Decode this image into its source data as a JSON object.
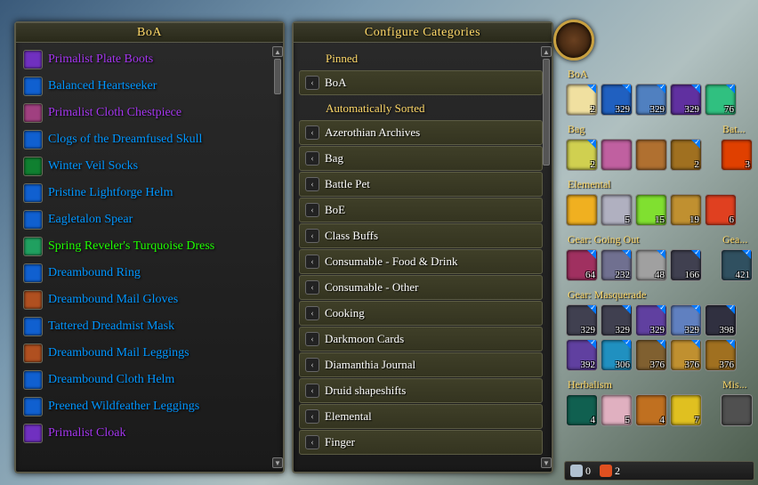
{
  "boa_panel": {
    "title": "BoA",
    "items": [
      {
        "name": "Primalist Plate Boots",
        "quality": "epic",
        "icon": "#7030c0"
      },
      {
        "name": "Balanced Heartseeker",
        "quality": "rare",
        "icon": "#1060d0"
      },
      {
        "name": "Primalist Cloth Chestpiece",
        "quality": "epic",
        "icon": "#a04080"
      },
      {
        "name": "Clogs of the Dreamfused Skull",
        "quality": "rare",
        "icon": "#1060d0"
      },
      {
        "name": "Winter Veil Socks",
        "quality": "rare",
        "icon": "#108030"
      },
      {
        "name": "Pristine Lightforge Helm",
        "quality": "rare",
        "icon": "#1060d0"
      },
      {
        "name": "Eagletalon Spear",
        "quality": "rare",
        "icon": "#1060d0"
      },
      {
        "name": "Spring Reveler's Turquoise Dress",
        "quality": "uncommon",
        "icon": "#20a060"
      },
      {
        "name": "Dreambound Ring",
        "quality": "rare",
        "icon": "#1060d0"
      },
      {
        "name": "Dreambound Mail Gloves",
        "quality": "rare",
        "icon": "#b05020"
      },
      {
        "name": "Tattered Dreadmist Mask",
        "quality": "rare",
        "icon": "#1060d0"
      },
      {
        "name": "Dreambound Mail Leggings",
        "quality": "rare",
        "icon": "#b05020"
      },
      {
        "name": "Dreambound Cloth Helm",
        "quality": "rare",
        "icon": "#1060d0"
      },
      {
        "name": "Preened Wildfeather Leggings",
        "quality": "rare",
        "icon": "#1060d0"
      },
      {
        "name": "Primalist Cloak",
        "quality": "epic",
        "icon": "#7030c0"
      }
    ]
  },
  "cfg_panel": {
    "title": "Configure Categories",
    "pinned_label": "Pinned",
    "auto_label": "Automatically Sorted",
    "pinned": [
      "BoA"
    ],
    "auto": [
      "Azerothian Archives",
      "Bag",
      "Battle Pet",
      "BoE",
      "Class Buffs",
      "Consumable - Food & Drink",
      "Consumable - Other",
      "Cooking",
      "Darkmoon Cards",
      "Diamanthia Journal",
      "Druid shapeshifts",
      "Elemental",
      "Finger"
    ]
  },
  "inventory": {
    "sections": [
      {
        "heading": "BoA",
        "slots": [
          {
            "bg": "#f0e0a0",
            "count": "2",
            "tick": true
          },
          {
            "bg": "#2060c0",
            "count": "329",
            "tick": true
          },
          {
            "bg": "#5080c0",
            "count": "329",
            "tick": true
          },
          {
            "bg": "#6030a0",
            "count": "329",
            "tick": true
          },
          {
            "bg": "#30c080",
            "count": "76",
            "tick": true
          }
        ]
      },
      {
        "split": true,
        "left": {
          "heading": "Bag",
          "slots": [
            {
              "bg": "#d0d050",
              "count": "2",
              "tick": true
            },
            {
              "bg": "#c060a0",
              "count": "",
              "tick": false
            },
            {
              "bg": "#b07030",
              "count": "",
              "tick": false
            },
            {
              "bg": "#a07020",
              "count": "2",
              "tick": true
            }
          ]
        },
        "right": {
          "heading": "Bat...",
          "slots": [
            {
              "bg": "#e04000",
              "count": "3",
              "tick": false
            }
          ]
        }
      },
      {
        "heading": "Elemental",
        "slots": [
          {
            "bg": "#f0b020",
            "count": "",
            "tick": false
          },
          {
            "bg": "#b0b0c0",
            "count": "5",
            "tick": false
          },
          {
            "bg": "#80e030",
            "count": "15",
            "tick": false
          },
          {
            "bg": "#c09030",
            "count": "19",
            "tick": false
          },
          {
            "bg": "#e04020",
            "count": "6",
            "tick": false
          }
        ]
      },
      {
        "split": true,
        "left": {
          "heading": "Gear: Going Out",
          "slots": [
            {
              "bg": "#a03060",
              "count": "64",
              "tick": true
            },
            {
              "bg": "#707090",
              "count": "232",
              "tick": true
            },
            {
              "bg": "#a0a0a0",
              "count": "48",
              "tick": true
            },
            {
              "bg": "#404050",
              "count": "166",
              "tick": true
            }
          ]
        },
        "right": {
          "heading": "Gea...",
          "slots": [
            {
              "bg": "#305060",
              "count": "421",
              "tick": true
            }
          ]
        }
      },
      {
        "heading": "Gear: Masquerade",
        "slots": [
          {
            "bg": "#404050",
            "count": "329",
            "tick": true
          },
          {
            "bg": "#404050",
            "count": "329",
            "tick": true
          },
          {
            "bg": "#6040a0",
            "count": "329",
            "tick": true
          },
          {
            "bg": "#6080c0",
            "count": "329",
            "tick": true
          },
          {
            "bg": "#303040",
            "count": "398",
            "tick": true
          },
          {
            "bg": "#6040a0",
            "count": "392",
            "tick": true
          },
          {
            "bg": "#2090c0",
            "count": "306",
            "tick": true
          },
          {
            "bg": "#806030",
            "count": "376",
            "tick": true
          },
          {
            "bg": "#c09030",
            "count": "376",
            "tick": true
          },
          {
            "bg": "#a07020",
            "count": "376",
            "tick": true
          }
        ]
      },
      {
        "split": true,
        "left": {
          "heading": "Herbalism",
          "slots": [
            {
              "bg": "#106050",
              "count": "4",
              "tick": false
            },
            {
              "bg": "#e0b0c0",
              "count": "5",
              "tick": false
            },
            {
              "bg": "#c07020",
              "count": "4",
              "tick": false
            },
            {
              "bg": "#e0c020",
              "count": "7",
              "tick": false
            }
          ]
        },
        "right": {
          "heading": "Mis...",
          "slots": [
            {
              "bg": "#505050",
              "count": "",
              "tick": false
            }
          ]
        }
      }
    ],
    "currency": [
      {
        "icon": "#b0c0d0",
        "value": "0"
      },
      {
        "icon": "#e05020",
        "value": "2"
      }
    ]
  }
}
